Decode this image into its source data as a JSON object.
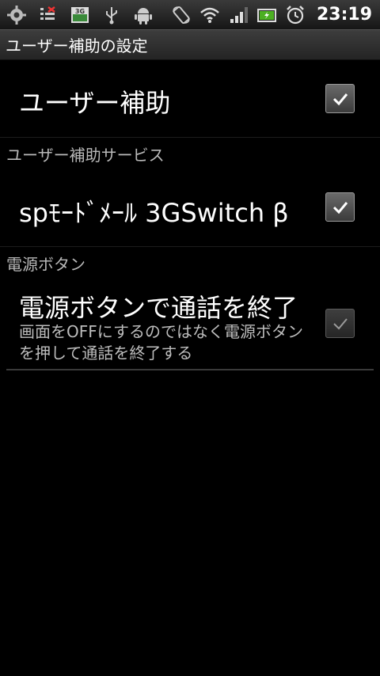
{
  "status_bar": {
    "time": "23:19",
    "icons": [
      "settings-gear-icon",
      "signal-alert-icon",
      "3g-data-icon",
      "usb-icon",
      "android-debug-icon",
      "rotate-icon",
      "wifi-icon",
      "cell-signal-icon",
      "battery-icon",
      "alarm-clock-icon"
    ]
  },
  "header": {
    "title": "ユーザー補助の設定"
  },
  "settings": {
    "accessibility": {
      "title": "ユーザー補助",
      "checked": true
    },
    "services_category": "ユーザー補助サービス",
    "service_item": {
      "title": "spﾓｰﾄﾞﾒｰﾙ 3GSwitch β",
      "checked": true
    },
    "power_category": "電源ボタン",
    "power_item": {
      "title": "電源ボタンで通話を終了",
      "summary": "画面をOFFにするのではなく電源ボタンを押して通話を終了する",
      "checked": true,
      "enabled": false
    }
  }
}
